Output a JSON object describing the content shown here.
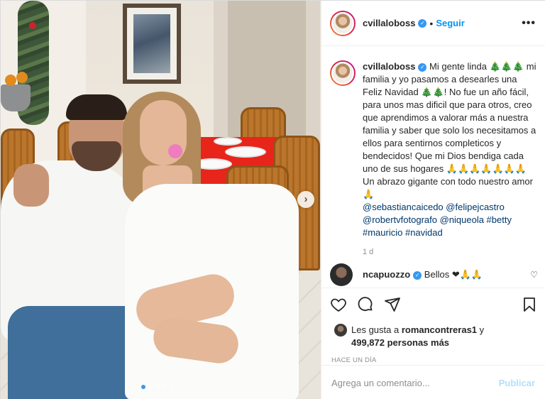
{
  "post": {
    "username": "cvillaloboss",
    "follow_label": "Seguir",
    "separator": "•",
    "more_label": "•••"
  },
  "caption": {
    "username": "cvillaloboss",
    "text": "Mi gente linda 🎄🎄🎄 mi familia y yo pasamos a desearles una Feliz Navidad 🎄🎄! No fue un año fácil, para unos mas dificil que para otros, creo que aprendimos a valorar más a nuestra familia y saber que solo los necesitamos a ellos para sentirnos completicos y bendecidos! Que mi Dios bendiga cada uno de sus hogares 🙏🙏🙏🙏🙏🙏🙏Un abrazo gigante con todo nuestro amor🙏",
    "mentions": [
      "@sebastiancaicedo",
      "@felipejcastro"
    ],
    "mentions2": "@robertvfotografo @niqueola #betty",
    "hashtags": "#mauricio #navidad",
    "time": "1 d"
  },
  "comment": {
    "username": "ncapuozzo",
    "text": "Bellos ❤🙏🙏"
  },
  "likes": {
    "prefix": "Les gusta a ",
    "user": "romancontreras1",
    "suffix": " y",
    "count": "499,872 personas más"
  },
  "post_time": "HACE UN DÍA",
  "add_comment": {
    "placeholder": "Agrega un comentario...",
    "post_label": "Publicar"
  },
  "carousel": {
    "slides": 5,
    "active": 0
  },
  "colors": {
    "accent": "#0095f6",
    "verified": "#3897f0",
    "link": "#00376b"
  }
}
